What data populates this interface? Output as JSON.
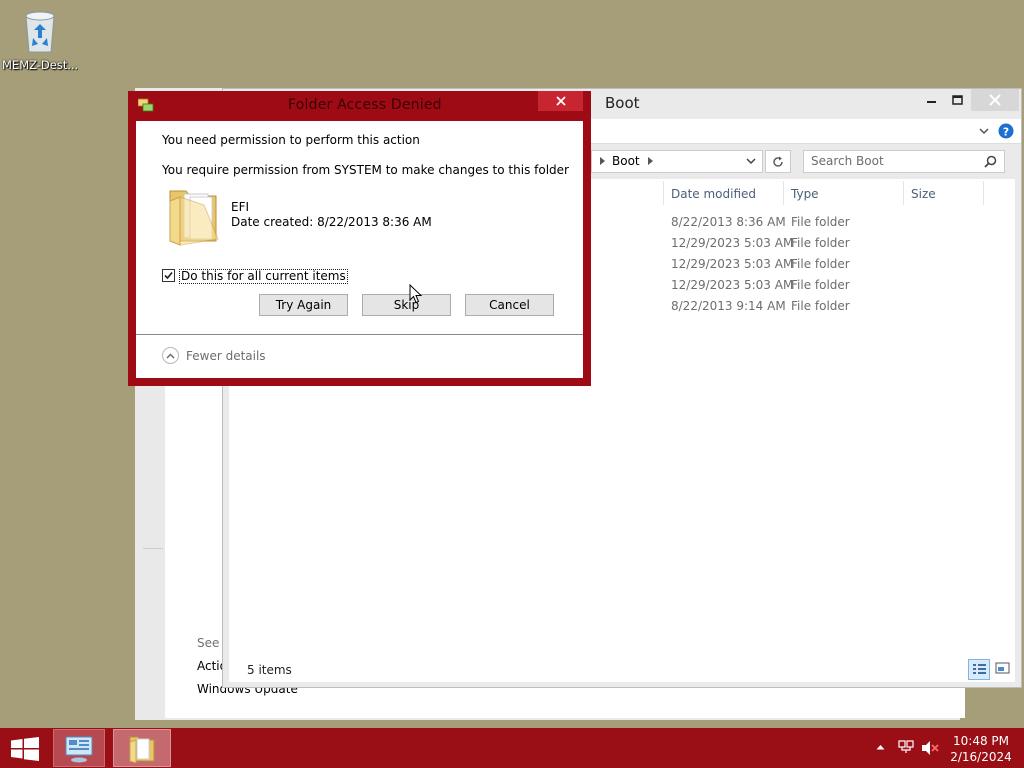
{
  "desktop": {
    "icon_label": "MEMZ-Dest..."
  },
  "control_panel": {
    "see_also": "See a",
    "action": "Actio",
    "windows_update": "Windows Update"
  },
  "explorer": {
    "title": "Boot",
    "address": "Boot",
    "search_placeholder": "Search Boot",
    "columns": {
      "date": "Date modified",
      "type": "Type",
      "size": "Size"
    },
    "rows": [
      {
        "date": "8/22/2013 8:36 AM",
        "type": "File folder"
      },
      {
        "date": "12/29/2023 5:03 AM",
        "type": "File folder"
      },
      {
        "date": "12/29/2023 5:03 AM",
        "type": "File folder"
      },
      {
        "date": "12/29/2023 5:03 AM",
        "type": "File folder"
      },
      {
        "date": "8/22/2013 9:14 AM",
        "type": "File folder"
      }
    ],
    "status": "5 items"
  },
  "dialog": {
    "title": "Folder Access Denied",
    "message": "You need permission to perform this action",
    "detail": "You require permission from SYSTEM to make changes to this folder",
    "item_name": "EFI",
    "item_date": "Date created: 8/22/2013 8:36 AM",
    "checkbox_label": "Do this for all current items",
    "checkbox_checked": true,
    "buttons": {
      "try_again": "Try Again",
      "skip": "Skip",
      "cancel": "Cancel"
    },
    "fewer_details": "Fewer details"
  },
  "taskbar": {
    "time": "10:48 PM",
    "date": "2/16/2024"
  },
  "colors": {
    "desktop": "#a59e78",
    "taskbar": "#9a0e16",
    "dialog_frame": "#9e0b14",
    "close_button": "#c7252f"
  }
}
